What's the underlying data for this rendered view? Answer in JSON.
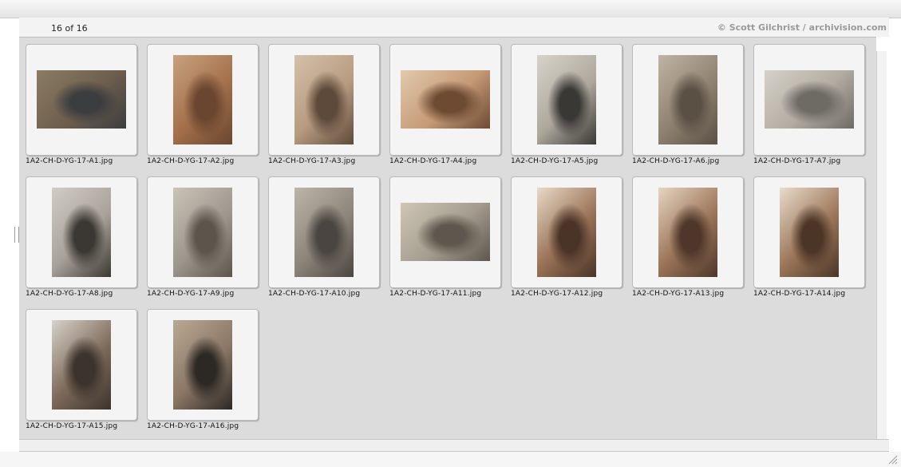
{
  "header": {
    "counter": "16 of 16",
    "credit": "© Scott Gilchrist / archivision.com"
  },
  "images": [
    {
      "filename": "1A2-CH-D-YG-17-A1.jpg",
      "thumb_orientation": "landscape",
      "palette": [
        "#6e5e4e",
        "#3c3d3f",
        "#8b7c64"
      ]
    },
    {
      "filename": "1A2-CH-D-YG-17-A2.jpg",
      "thumb_orientation": "portrait",
      "palette": [
        "#a3704a",
        "#6a4530",
        "#c8a27e"
      ]
    },
    {
      "filename": "1A2-CH-D-YG-17-A3.jpg",
      "thumb_orientation": "portrait",
      "palette": [
        "#b79b7f",
        "#5d4a3a",
        "#d4c1aa"
      ]
    },
    {
      "filename": "1A2-CH-D-YG-17-A4.jpg",
      "thumb_orientation": "landscape",
      "palette": [
        "#c59a76",
        "#6d4a32",
        "#e2c9ad"
      ]
    },
    {
      "filename": "1A2-CH-D-YG-17-A5.jpg",
      "thumb_orientation": "portrait",
      "palette": [
        "#aea89c",
        "#3a3835",
        "#d8d3ca"
      ]
    },
    {
      "filename": "1A2-CH-D-YG-17-A6.jpg",
      "thumb_orientation": "portrait",
      "palette": [
        "#8e8170",
        "#5a5044",
        "#c0b4a2"
      ]
    },
    {
      "filename": "1A2-CH-D-YG-17-A7.jpg",
      "thumb_orientation": "landscape",
      "palette": [
        "#b2aca2",
        "#6e6a64",
        "#d6d1c8"
      ]
    },
    {
      "filename": "1A2-CH-D-YG-17-A8.jpg",
      "thumb_orientation": "portrait",
      "palette": [
        "#a8a29a",
        "#3b3732",
        "#d1ccc4"
      ]
    },
    {
      "filename": "1A2-CH-D-YG-17-A9.jpg",
      "thumb_orientation": "portrait",
      "palette": [
        "#9d968c",
        "#5b554c",
        "#c9c3b8"
      ]
    },
    {
      "filename": "1A2-CH-D-YG-17-A10.jpg",
      "thumb_orientation": "portrait",
      "palette": [
        "#8d857a",
        "#4a4540",
        "#bdb5a8"
      ]
    },
    {
      "filename": "1A2-CH-D-YG-17-A11.jpg",
      "thumb_orientation": "landscape",
      "palette": [
        "#a49c8e",
        "#5e574d",
        "#cfc6b6"
      ]
    },
    {
      "filename": "1A2-CH-D-YG-17-A12.jpg",
      "thumb_orientation": "portrait",
      "palette": [
        "#9a7256",
        "#4a3428",
        "#e8d9c7"
      ]
    },
    {
      "filename": "1A2-CH-D-YG-17-A13.jpg",
      "thumb_orientation": "portrait",
      "palette": [
        "#9b7458",
        "#4e372a",
        "#e6d5c0"
      ]
    },
    {
      "filename": "1A2-CH-D-YG-17-A14.jpg",
      "thumb_orientation": "portrait",
      "palette": [
        "#9c7659",
        "#4b3527",
        "#e9dccb"
      ]
    },
    {
      "filename": "1A2-CH-D-YG-17-A15.jpg",
      "thumb_orientation": "portrait",
      "palette": [
        "#7d6a5a",
        "#3c332c",
        "#d8d2ca"
      ]
    },
    {
      "filename": "1A2-CH-D-YG-17-A16.jpg",
      "thumb_orientation": "portrait",
      "palette": [
        "#8a7766",
        "#2c2824",
        "#b9a994"
      ]
    }
  ]
}
